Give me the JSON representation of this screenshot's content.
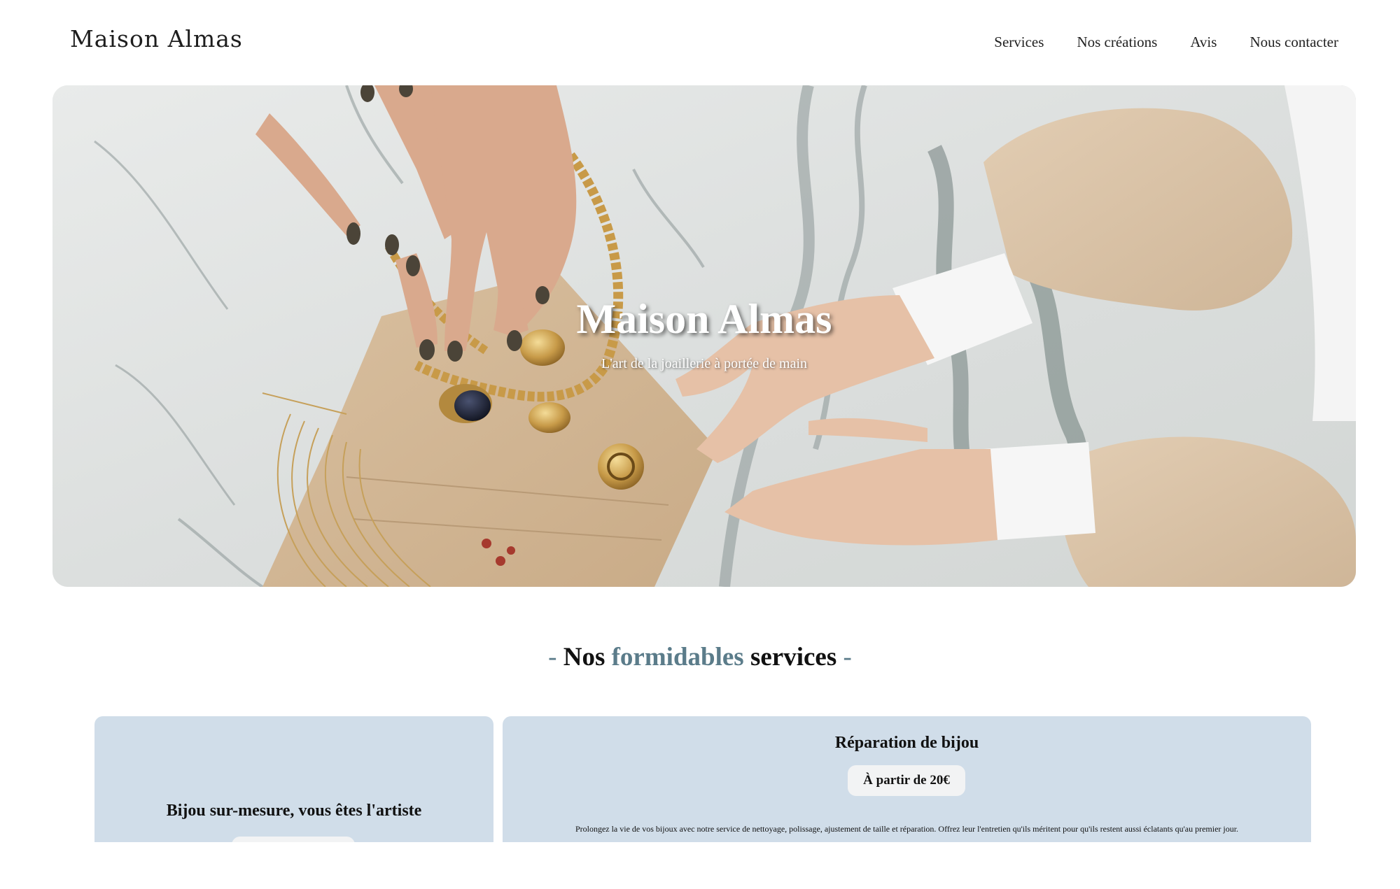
{
  "header": {
    "logo": "Maison Almas",
    "nav": [
      "Services",
      "Nos créations",
      "Avis",
      "Nous contacter"
    ]
  },
  "hero": {
    "title": "Maison Almas",
    "subtitle": "L'art de la joaillerie à portée de main"
  },
  "services": {
    "heading": {
      "dash_left": "-",
      "word1": "Nos",
      "accent": "formidables",
      "word2": "services",
      "dash_right": "-"
    },
    "cards": [
      {
        "title": "Bijou sur-mesure, vous êtes l'artiste"
      },
      {
        "title": "Réparation de bijou",
        "price": "À partir de 20€",
        "description": "Prolongez la vie de vos bijoux avec notre service de nettoyage, polissage, ajustement de taille et réparation. Offrez leur l'entretien qu'ils méritent pour qu'ils restent aussi éclatants qu'au premier jour."
      }
    ]
  },
  "colors": {
    "accent": "#5b7c8a",
    "card_bg": "#d0dde9",
    "pill_bg": "#f2f3f4"
  }
}
